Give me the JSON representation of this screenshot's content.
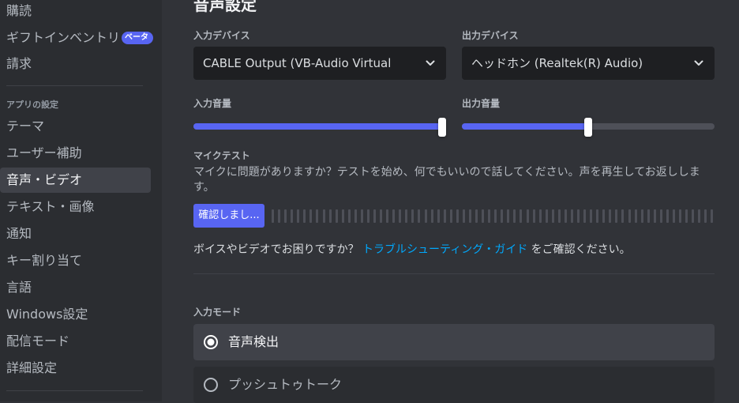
{
  "sidebar": {
    "items": [
      {
        "label": "購読"
      },
      {
        "label": "ギフトインベントリ",
        "badge": "ベータ"
      },
      {
        "label": "請求"
      }
    ],
    "app_settings_header": "アプリの設定",
    "app_items": [
      {
        "label": "テーマ"
      },
      {
        "label": "ユーザー補助"
      },
      {
        "label": "音声・ビデオ",
        "selected": true
      },
      {
        "label": "テキスト・画像"
      },
      {
        "label": "通知"
      },
      {
        "label": "キー割り当て"
      },
      {
        "label": "言語"
      },
      {
        "label": "Windows設定"
      },
      {
        "label": "配信モード"
      },
      {
        "label": "詳細設定"
      }
    ]
  },
  "main": {
    "title": "音声設定",
    "input_device": {
      "label": "入力デバイス",
      "value": "CABLE Output (VB-Audio Virtual"
    },
    "output_device": {
      "label": "出力デバイス",
      "value": "ヘッドホン (Realtek(R) Audio)"
    },
    "input_volume": {
      "label": "入力音量",
      "value": 1.0
    },
    "output_volume": {
      "label": "出力音量",
      "value": 0.5
    },
    "mic_test": {
      "title": "マイクテスト",
      "description": "マイクに問題がありますか？テストを始め、何でもいいので話してください。声を再生してお返しします。",
      "button_label": "確認しまし..."
    },
    "help": {
      "prefix": "ボイスやビデオでお困りですか？",
      "link": "トラブルシューティング・ガイド",
      "suffix": "をご確認ください。"
    },
    "input_mode": {
      "label": "入力モード",
      "options": [
        {
          "label": "音声検出",
          "selected": true
        },
        {
          "label": "プッシュトゥトーク",
          "selected": false
        }
      ]
    }
  },
  "colors": {
    "accent": "#5865f2",
    "link": "#00a8fc",
    "background": "#313338",
    "sidebar": "#2b2d31",
    "input_bg": "#1e1f22"
  }
}
